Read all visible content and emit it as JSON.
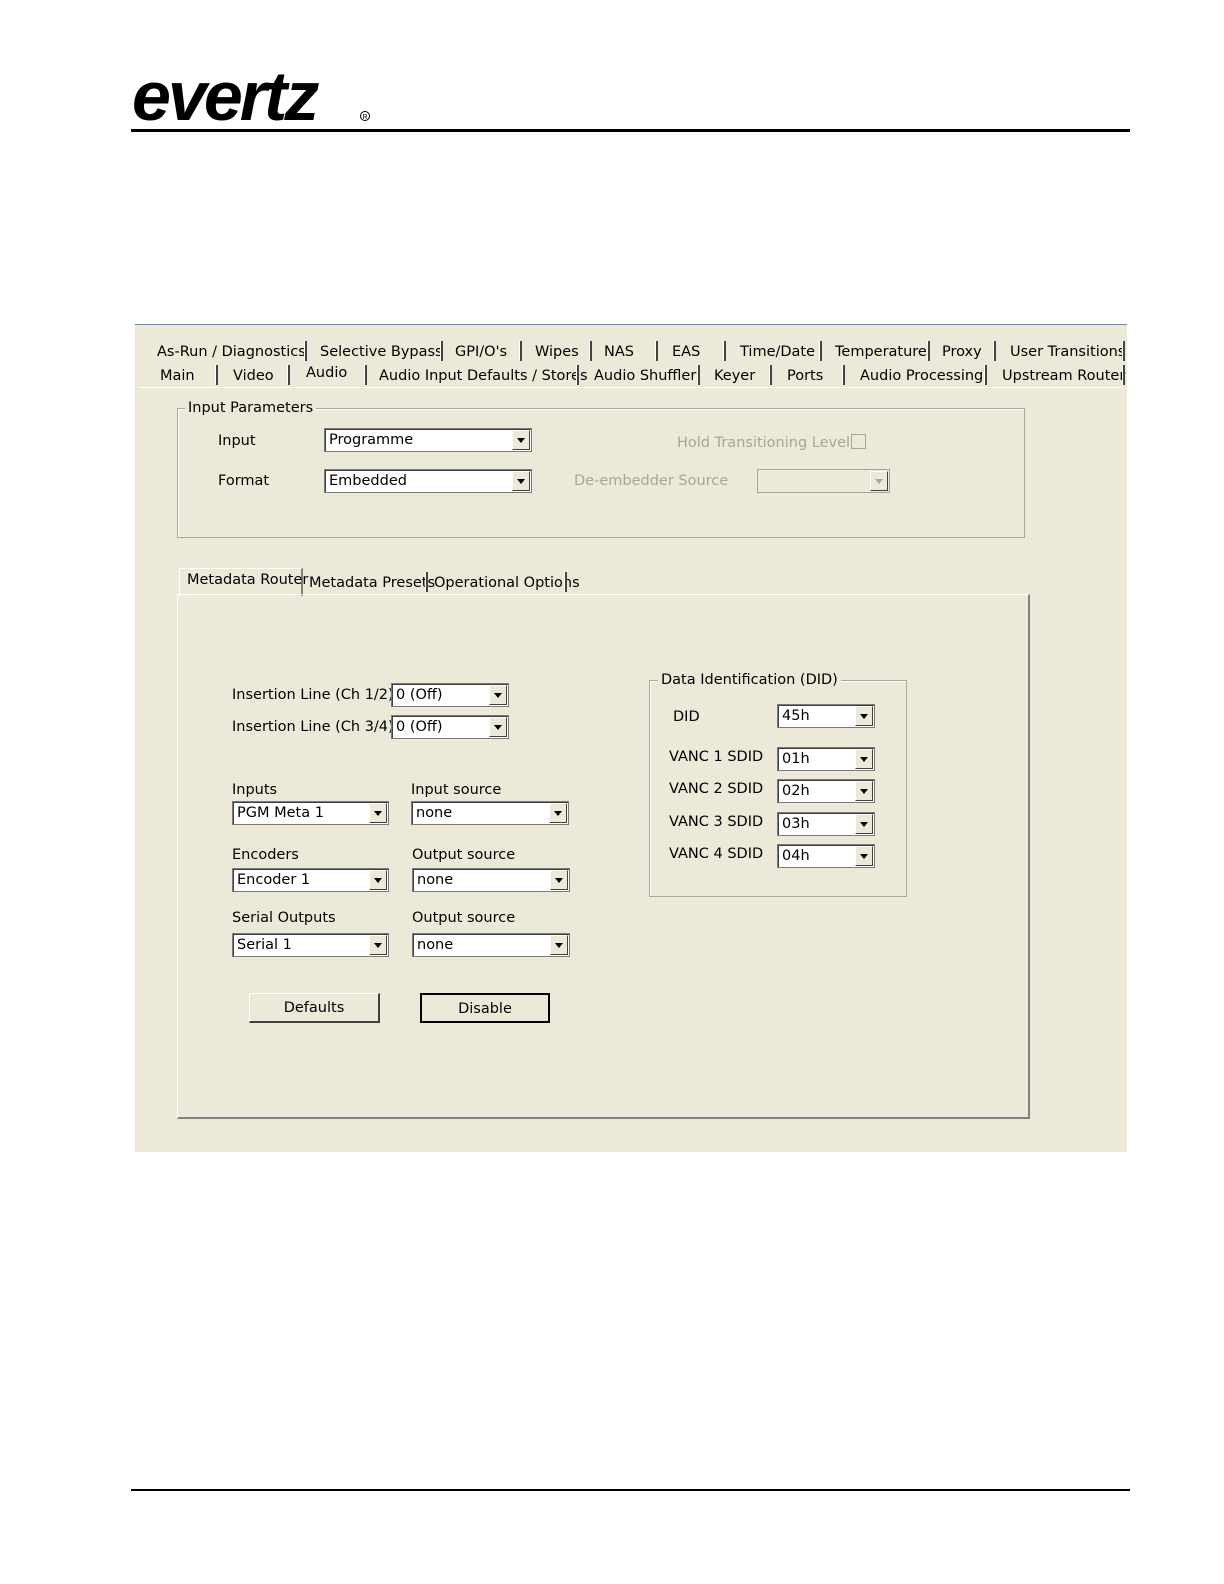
{
  "brand": {
    "logo_text": "evertz"
  },
  "tabs_row1": [
    "As-Run / Diagnostics",
    "Selective Bypass",
    "GPI/O's",
    "Wipes",
    "NAS",
    "EAS",
    "Time/Date",
    "Temperature",
    "Proxy",
    "User Transitions"
  ],
  "tabs_row2": [
    "Main",
    "Video",
    "Audio",
    "Audio Input Defaults / Stores",
    "Audio Shuffler",
    "Keyer",
    "Ports",
    "Audio Processing",
    "Upstream Router"
  ],
  "input_parameters": {
    "title": "Input Parameters",
    "input_label": "Input",
    "input_value": "Programme",
    "format_label": "Format",
    "format_value": "Embedded",
    "hold_label": "Hold Transitioning Level",
    "deembedder_label": "De-embedder Source",
    "deembedder_value": ""
  },
  "subtabs": [
    "Metadata Router",
    "Metadata Presets",
    "Operational Options"
  ],
  "metadata": {
    "ins12_label": "Insertion Line (Ch 1/2)",
    "ins12_value": "0 (Off)",
    "ins34_label": "Insertion Line (Ch 3/4)",
    "ins34_value": "0 (Off)",
    "inputs_label": "Inputs",
    "inputs_value": "PGM Meta 1",
    "input_source_label": "Input source",
    "input_source_value": "none",
    "encoders_label": "Encoders",
    "encoders_value": "Encoder 1",
    "enc_output_source_label": "Output source",
    "enc_output_source_value": "none",
    "serial_label": "Serial Outputs",
    "serial_value": "Serial 1",
    "ser_output_source_label": "Output source",
    "ser_output_source_value": "none",
    "defaults_button": "Defaults",
    "disable_button": "Disable"
  },
  "did": {
    "title": "Data Identification (DID)",
    "did_label": "DID",
    "did_value": "45h",
    "vanc1_label": "VANC 1 SDID",
    "vanc1_value": "01h",
    "vanc2_label": "VANC 2 SDID",
    "vanc2_value": "02h",
    "vanc3_label": "VANC 3 SDID",
    "vanc3_value": "03h",
    "vanc4_label": "VANC 4 SDID",
    "vanc4_value": "04h"
  }
}
